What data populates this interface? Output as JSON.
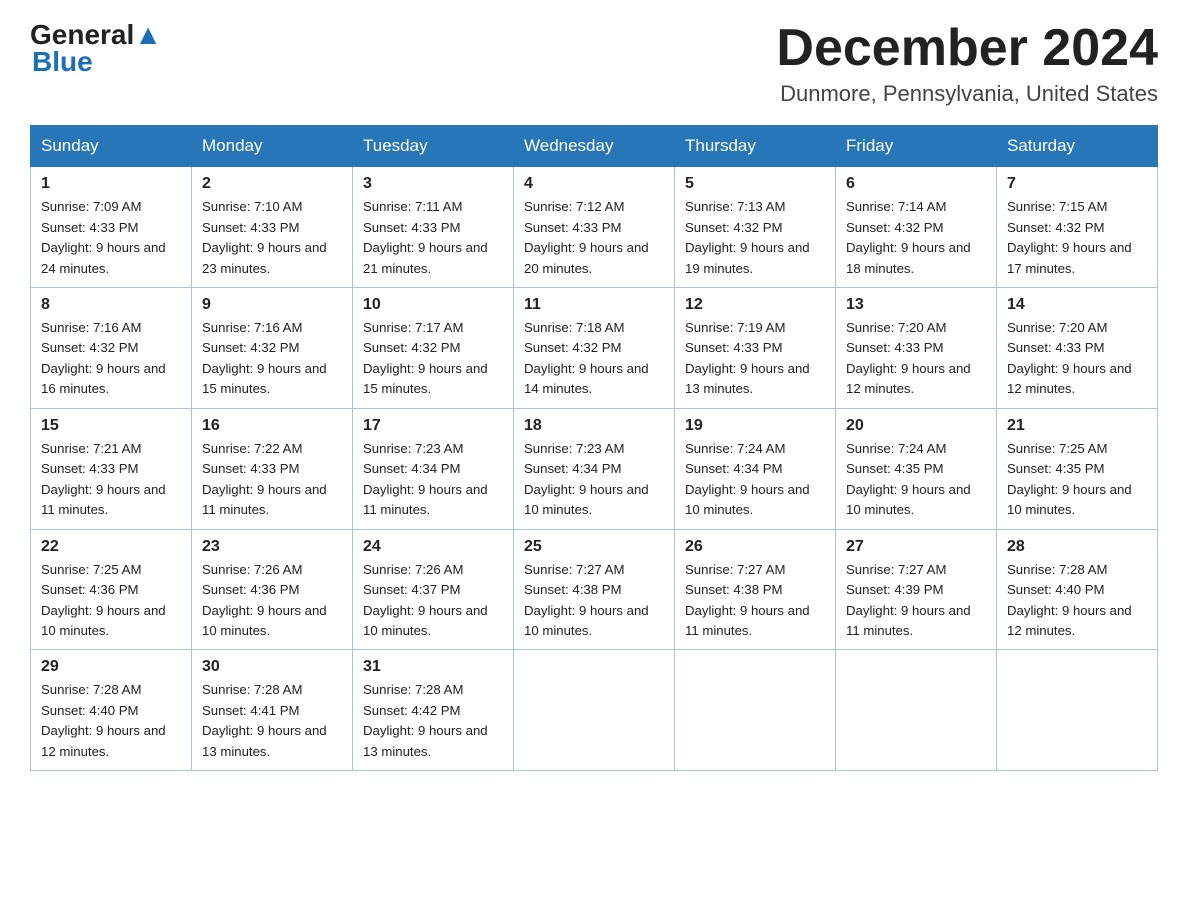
{
  "header": {
    "logo_text1": "General",
    "logo_text2": "Blue",
    "month_title": "December 2024",
    "location": "Dunmore, Pennsylvania, United States"
  },
  "days_of_week": [
    "Sunday",
    "Monday",
    "Tuesday",
    "Wednesday",
    "Thursday",
    "Friday",
    "Saturday"
  ],
  "weeks": [
    [
      {
        "num": "1",
        "sunrise": "7:09 AM",
        "sunset": "4:33 PM",
        "daylight": "9 hours and 24 minutes."
      },
      {
        "num": "2",
        "sunrise": "7:10 AM",
        "sunset": "4:33 PM",
        "daylight": "9 hours and 23 minutes."
      },
      {
        "num": "3",
        "sunrise": "7:11 AM",
        "sunset": "4:33 PM",
        "daylight": "9 hours and 21 minutes."
      },
      {
        "num": "4",
        "sunrise": "7:12 AM",
        "sunset": "4:33 PM",
        "daylight": "9 hours and 20 minutes."
      },
      {
        "num": "5",
        "sunrise": "7:13 AM",
        "sunset": "4:32 PM",
        "daylight": "9 hours and 19 minutes."
      },
      {
        "num": "6",
        "sunrise": "7:14 AM",
        "sunset": "4:32 PM",
        "daylight": "9 hours and 18 minutes."
      },
      {
        "num": "7",
        "sunrise": "7:15 AM",
        "sunset": "4:32 PM",
        "daylight": "9 hours and 17 minutes."
      }
    ],
    [
      {
        "num": "8",
        "sunrise": "7:16 AM",
        "sunset": "4:32 PM",
        "daylight": "9 hours and 16 minutes."
      },
      {
        "num": "9",
        "sunrise": "7:16 AM",
        "sunset": "4:32 PM",
        "daylight": "9 hours and 15 minutes."
      },
      {
        "num": "10",
        "sunrise": "7:17 AM",
        "sunset": "4:32 PM",
        "daylight": "9 hours and 15 minutes."
      },
      {
        "num": "11",
        "sunrise": "7:18 AM",
        "sunset": "4:32 PM",
        "daylight": "9 hours and 14 minutes."
      },
      {
        "num": "12",
        "sunrise": "7:19 AM",
        "sunset": "4:33 PM",
        "daylight": "9 hours and 13 minutes."
      },
      {
        "num": "13",
        "sunrise": "7:20 AM",
        "sunset": "4:33 PM",
        "daylight": "9 hours and 12 minutes."
      },
      {
        "num": "14",
        "sunrise": "7:20 AM",
        "sunset": "4:33 PM",
        "daylight": "9 hours and 12 minutes."
      }
    ],
    [
      {
        "num": "15",
        "sunrise": "7:21 AM",
        "sunset": "4:33 PM",
        "daylight": "9 hours and 11 minutes."
      },
      {
        "num": "16",
        "sunrise": "7:22 AM",
        "sunset": "4:33 PM",
        "daylight": "9 hours and 11 minutes."
      },
      {
        "num": "17",
        "sunrise": "7:23 AM",
        "sunset": "4:34 PM",
        "daylight": "9 hours and 11 minutes."
      },
      {
        "num": "18",
        "sunrise": "7:23 AM",
        "sunset": "4:34 PM",
        "daylight": "9 hours and 10 minutes."
      },
      {
        "num": "19",
        "sunrise": "7:24 AM",
        "sunset": "4:34 PM",
        "daylight": "9 hours and 10 minutes."
      },
      {
        "num": "20",
        "sunrise": "7:24 AM",
        "sunset": "4:35 PM",
        "daylight": "9 hours and 10 minutes."
      },
      {
        "num": "21",
        "sunrise": "7:25 AM",
        "sunset": "4:35 PM",
        "daylight": "9 hours and 10 minutes."
      }
    ],
    [
      {
        "num": "22",
        "sunrise": "7:25 AM",
        "sunset": "4:36 PM",
        "daylight": "9 hours and 10 minutes."
      },
      {
        "num": "23",
        "sunrise": "7:26 AM",
        "sunset": "4:36 PM",
        "daylight": "9 hours and 10 minutes."
      },
      {
        "num": "24",
        "sunrise": "7:26 AM",
        "sunset": "4:37 PM",
        "daylight": "9 hours and 10 minutes."
      },
      {
        "num": "25",
        "sunrise": "7:27 AM",
        "sunset": "4:38 PM",
        "daylight": "9 hours and 10 minutes."
      },
      {
        "num": "26",
        "sunrise": "7:27 AM",
        "sunset": "4:38 PM",
        "daylight": "9 hours and 11 minutes."
      },
      {
        "num": "27",
        "sunrise": "7:27 AM",
        "sunset": "4:39 PM",
        "daylight": "9 hours and 11 minutes."
      },
      {
        "num": "28",
        "sunrise": "7:28 AM",
        "sunset": "4:40 PM",
        "daylight": "9 hours and 12 minutes."
      }
    ],
    [
      {
        "num": "29",
        "sunrise": "7:28 AM",
        "sunset": "4:40 PM",
        "daylight": "9 hours and 12 minutes."
      },
      {
        "num": "30",
        "sunrise": "7:28 AM",
        "sunset": "4:41 PM",
        "daylight": "9 hours and 13 minutes."
      },
      {
        "num": "31",
        "sunrise": "7:28 AM",
        "sunset": "4:42 PM",
        "daylight": "9 hours and 13 minutes."
      },
      null,
      null,
      null,
      null
    ]
  ]
}
